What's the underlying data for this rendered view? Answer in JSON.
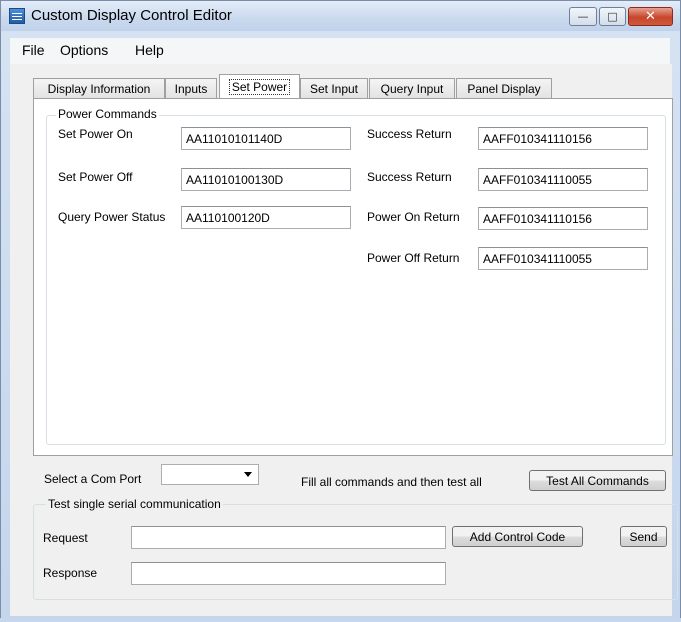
{
  "window": {
    "title": "Custom Display Control Editor",
    "controls": {
      "minimize": "—",
      "maximize": "□",
      "close": "✕"
    }
  },
  "menu": [
    "File",
    "Options",
    "Help"
  ],
  "tabs": [
    {
      "label": "Display Information",
      "active": false
    },
    {
      "label": "Inputs",
      "active": false
    },
    {
      "label": "Set Power",
      "active": true
    },
    {
      "label": "Set Input",
      "active": false
    },
    {
      "label": "Query Input",
      "active": false
    },
    {
      "label": "Panel Display",
      "active": false
    }
  ],
  "power": {
    "group_label": "Power Commands",
    "set_on_label": "Set Power On",
    "set_on_value": "AA11010101140D",
    "set_off_label": "Set Power Off",
    "set_off_value": "AA11010100130D",
    "query_label": "Query Power Status",
    "query_value": "AA110100120D",
    "success_return_label_1": "Success Return",
    "success_return_value_1": "AAFF010341110156",
    "success_return_label_2": "Success Return",
    "success_return_value_2": "AAFF010341110055",
    "power_on_return_label": "Power On Return",
    "power_on_return_value": "AAFF010341110156",
    "power_off_return_label": "Power Off  Return",
    "power_off_return_value": "AAFF010341110055"
  },
  "bottom": {
    "com_port_label": "Select a Com Port",
    "com_port_value": "",
    "fill_hint": "Fill all commands and then test all",
    "test_all_button": "Test All Commands",
    "serial_group_label": "Test single serial communication",
    "request_label": "Request",
    "request_value": "",
    "add_control_code_button": "Add Control Code",
    "send_button": "Send",
    "response_label": "Response",
    "response_value": ""
  }
}
